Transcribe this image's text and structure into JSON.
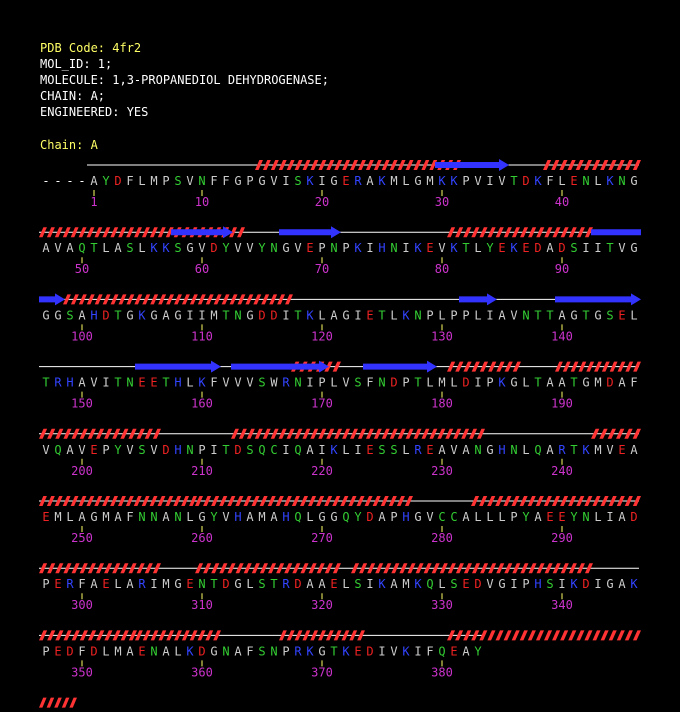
{
  "header": {
    "pdb_code": "PDB Code: 4fr2",
    "mol_id": "MOL_ID: 1;",
    "molecule": "MOLECULE: 1,3-PROPANEDIOL DEHYDROGENASE;",
    "chain": "CHAIN: A;",
    "engineered": "ENGINEERED: YES",
    "chain_label": "Chain: A"
  },
  "colors": {
    "background": "#000000",
    "header_text": "#ffffff",
    "highlight_text": "#ffff66",
    "residue_numbers": "#cc33cc",
    "hydrophobic": "#cccccc",
    "polar": "#33cc33",
    "acidic": "#ee2222",
    "basic": "#3344ff",
    "gap": "#ffffff",
    "helix": "#ff3333",
    "strand": "#3333ff",
    "coil": "#ffffff"
  },
  "sequence": {
    "chain": "A",
    "gap_prefix": "----",
    "residues": "AYDFLMPSVNFFGPGVISKIGERAKMLGMKKPVIVTDKFLENLKNGAVAQTLASLKKSGVDYVVYNGVEPNPKIHNIKEVKTLYEKEDADSIITVGGGSAHDTGKGAGIIMTNGDDITKLAGIETLKNPLPPLIAVNTTAGTGSELTRHAVITNEETHLKFVVVSWRNIPLVSFNDPTLMLDIPKGLTAATGMDAFVQAVEPYVSVDHNPITDSQCIQAIKLIESSLREAVANGHNLQARTKMVEAEMLAGMAFNNANLGYVHAMAHQLGGQYDAPHGVCCALLLPYAEEYNLIADPERFAELARIMGENTDGLSTRDAAELSIKAMKQLSEDVGIPHSIKDIGAKPEDFDLMAENALKDGNAFSNPRKGTKEDIVKIFQEAY",
    "residues_per_row": 50,
    "number_ticks": [
      "1",
      "10",
      "20",
      "30",
      "40",
      "50",
      "60",
      "70",
      "80",
      "90",
      "100",
      "110",
      "120",
      "130",
      "140",
      "150",
      "160",
      "170",
      "180",
      "190",
      "200",
      "210",
      "220",
      "230",
      "240",
      "250",
      "260",
      "270",
      "280",
      "290",
      "300",
      "310",
      "320",
      "330",
      "340",
      "350",
      "360",
      "370",
      "380"
    ]
  },
  "secondary_structure": {
    "helices": [
      {
        "start": 15,
        "end": 31
      },
      {
        "start": 39,
        "end": 46
      },
      {
        "start": 47,
        "end": 63
      },
      {
        "start": 81,
        "end": 92
      },
      {
        "start": 99,
        "end": 117
      },
      {
        "start": 168,
        "end": 171
      },
      {
        "start": 181,
        "end": 186
      },
      {
        "start": 190,
        "end": 206
      },
      {
        "start": 213,
        "end": 233
      },
      {
        "start": 243,
        "end": 259
      },
      {
        "start": 260,
        "end": 277
      },
      {
        "start": 283,
        "end": 306
      },
      {
        "start": 310,
        "end": 321
      },
      {
        "start": 323,
        "end": 342
      },
      {
        "start": 347,
        "end": 354
      },
      {
        "start": 355,
        "end": 361
      },
      {
        "start": 367,
        "end": 373
      },
      {
        "start": 381,
        "end": 399
      }
    ],
    "strands": [
      {
        "start": 30,
        "end": 35
      },
      {
        "start": 58,
        "end": 62
      },
      {
        "start": 67,
        "end": 71
      },
      {
        "start": 93,
        "end": 98
      },
      {
        "start": 132,
        "end": 134
      },
      {
        "start": 140,
        "end": 146
      },
      {
        "start": 155,
        "end": 161
      },
      {
        "start": 163,
        "end": 170
      },
      {
        "start": 174,
        "end": 179
      }
    ]
  }
}
